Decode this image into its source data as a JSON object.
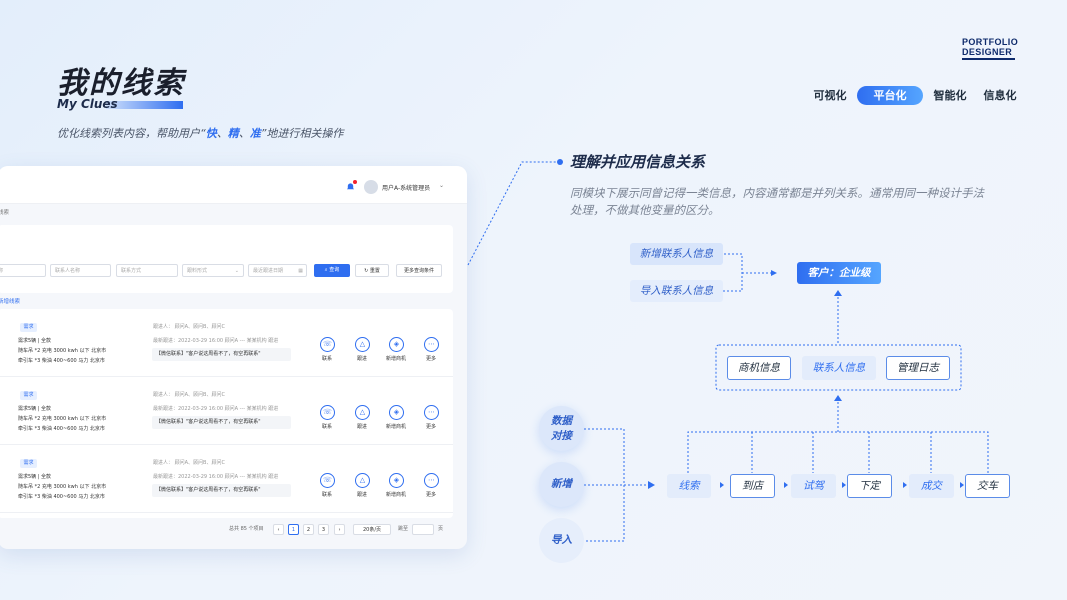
{
  "page": {
    "title": "我的线索",
    "subtitle": "My Clues",
    "desc_parts": [
      "优化线索列表内容，帮助用户“",
      "快",
      "、",
      "精",
      "、",
      "准",
      "”地进行相关操作"
    ]
  },
  "logo": {
    "line1": "PORTFOLIO",
    "line2": "DESIGNER"
  },
  "nav": {
    "items": [
      "可视化",
      "平台化",
      "智能化",
      "信息化"
    ],
    "active": "平台化"
  },
  "app": {
    "user": "用户A-系统管理员",
    "breadcrumb": "线索",
    "filters": [
      "名称",
      "联系人名称",
      "联系方式",
      "跟料形式",
      "最近跟进日期"
    ],
    "buttons": {
      "query": "查询",
      "reset": "重置",
      "more": "更多查询条件"
    },
    "add_lead": "新增线索",
    "rows": [
      {
        "tag": "需求",
        "line1": "需求5辆 | 全款",
        "line2": "随车吊 *2    充电    3000 kwh 以下    北京市",
        "line3": "牵引车 *3    柴油    400~600 马力    北京市",
        "followers": "跟进人：    顾问A、顾问B、顾问C",
        "latest": "最新跟进：2022-03-29 16:00    顾问A --- 某某机构 跟进",
        "quote": "【微信联系】\"客户说这周看不了，有空再联系\""
      },
      {
        "tag": "需求",
        "line1": "需求5辆 | 全款",
        "line2": "随车吊 *2    充电    3000 kwh 以下    北京市",
        "line3": "牵引车 *3    柴油    400~600 马力    北京市",
        "followers": "跟进人：    顾问A、顾问B、顾问C",
        "latest": "最新跟进：2022-03-29 16:00    顾问A --- 某某机构 跟进",
        "quote": "【微信联系】\"客户说这周看不了，有空再联系\""
      },
      {
        "tag": "需求",
        "line1": "需求5辆 | 全款",
        "line2": "随车吊 *2    充电    3000 kwh 以下    北京市",
        "line3": "牵引车 *3    柴油    400~600 马力    北京市",
        "followers": "跟进人：    顾问A、顾问B、顾问C",
        "latest": "最新跟进：2022-03-29 16:00    顾问A --- 某某机构 跟进",
        "quote": "【微信联系】\"客户说这周看不了，有空再联系\""
      }
    ],
    "actions": [
      "联系",
      "跟进",
      "新增商机",
      "更多"
    ],
    "pager": {
      "total": "总共 85 个项目",
      "pages": [
        "1",
        "2",
        "3"
      ],
      "size": "20条/页",
      "jump": "跳至",
      "unit": "页"
    }
  },
  "diagram": {
    "title": "理解并应用信息关系",
    "desc": "同模块下展示同曾记得一类信息，内容通常都是并列关系。通常用同一种设计手法处理，不做其他变量的区分。",
    "sources": [
      "新增联系人信息",
      "导入联系人信息"
    ],
    "customer": "客户：企业级",
    "group": [
      "商机信息",
      "联系人信息",
      "管理日志"
    ],
    "inputs": [
      "数据对接",
      "新增",
      "导入"
    ],
    "stages": [
      "线索",
      "到店",
      "试驾",
      "下定",
      "成交",
      "交车"
    ],
    "colors": {
      "accent": "#2f6ef0",
      "accent_light": "#55a5ff",
      "line": "#2f6ef0"
    }
  }
}
